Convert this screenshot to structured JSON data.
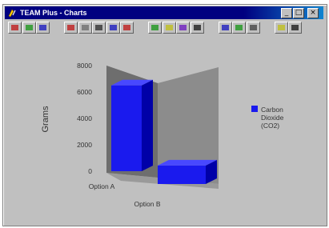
{
  "window": {
    "title": "TEAM Plus - Charts",
    "minimize_glyph": "_",
    "maximize_glyph": "□",
    "close_glyph": "×"
  },
  "toolbar": {
    "buttons": [
      {
        "icon": "chart-icon",
        "color": "#c04040"
      },
      {
        "icon": "table-icon",
        "color": "#40a040"
      },
      {
        "icon": "grid-icon",
        "color": "#4040c0"
      },
      {
        "icon": "bar-chart-icon",
        "color": "#c04040"
      },
      {
        "icon": "copy-icon",
        "color": "#808080"
      },
      {
        "icon": "print-icon",
        "color": "#505050"
      },
      {
        "icon": "column-chart-icon",
        "color": "#4040c0"
      },
      {
        "icon": "pie-chart-icon",
        "color": "#c04040"
      },
      {
        "icon": "line-chart-icon",
        "color": "#40a040"
      },
      {
        "icon": "area-chart-icon",
        "color": "#c0c040"
      },
      {
        "icon": "3d-chart-icon",
        "color": "#8040c0"
      },
      {
        "icon": "legend-icon",
        "color": "#404040"
      },
      {
        "icon": "gridlines-icon",
        "color": "#4040c0"
      },
      {
        "icon": "color-icon",
        "color": "#40a040"
      },
      {
        "icon": "font-icon",
        "color": "#606060"
      },
      {
        "icon": "help-icon",
        "color": "#c0c040"
      },
      {
        "icon": "exit-icon",
        "color": "#404040"
      }
    ]
  },
  "chart_data": {
    "type": "bar",
    "categories": [
      "Option A",
      "Option B"
    ],
    "series": [
      {
        "name": "Carbon Dioxide (CO2)",
        "values": [
          6500,
          1400
        ],
        "color": "#1a1aee"
      }
    ],
    "ylabel": "Grams",
    "xlabel": "",
    "ylim": [
      0,
      8000
    ],
    "yticks": [
      "8000",
      "6000",
      "4000",
      "2000",
      "0"
    ],
    "legend_label_lines": [
      "Carbon",
      "Dioxide",
      "(CO2)"
    ],
    "legend_position": "right",
    "style": "3d"
  }
}
